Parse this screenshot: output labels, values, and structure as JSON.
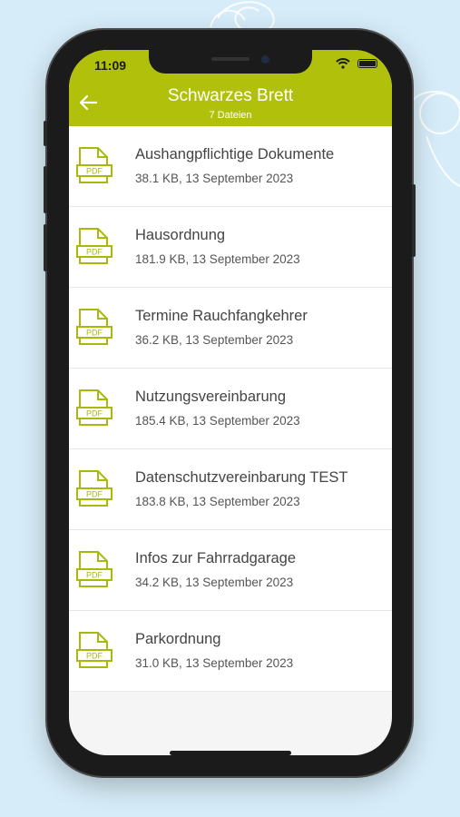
{
  "status_bar": {
    "time": "11:09"
  },
  "header": {
    "title": "Schwarzes Brett",
    "subtitle": "7 Dateien",
    "back_icon": "arrow-left-icon"
  },
  "colors": {
    "accent": "#b1c10b",
    "background": "#d6ecf8",
    "frame": "#1b1b1b"
  },
  "files": [
    {
      "name": "Aushangpflichtige Dokumente",
      "meta": "38.1 KB, 13 September 2023",
      "icon": "pdf-file-icon"
    },
    {
      "name": "Hausordnung",
      "meta": "181.9 KB, 13 September 2023",
      "icon": "pdf-file-icon"
    },
    {
      "name": "Termine Rauchfangkehrer",
      "meta": "36.2 KB, 13 September 2023",
      "icon": "pdf-file-icon"
    },
    {
      "name": "Nutzungsvereinbarung",
      "meta": "185.4 KB, 13 September 2023",
      "icon": "pdf-file-icon"
    },
    {
      "name": "Datenschutzvereinbarung TEST",
      "meta": "183.8 KB, 13 September 2023",
      "icon": "pdf-file-icon"
    },
    {
      "name": "Infos zur Fahrradgarage",
      "meta": "34.2 KB, 13 September 2023",
      "icon": "pdf-file-icon"
    },
    {
      "name": "Parkordnung",
      "meta": "31.0 KB, 13 September 2023",
      "icon": "pdf-file-icon"
    }
  ],
  "pdf_label": "PDF"
}
